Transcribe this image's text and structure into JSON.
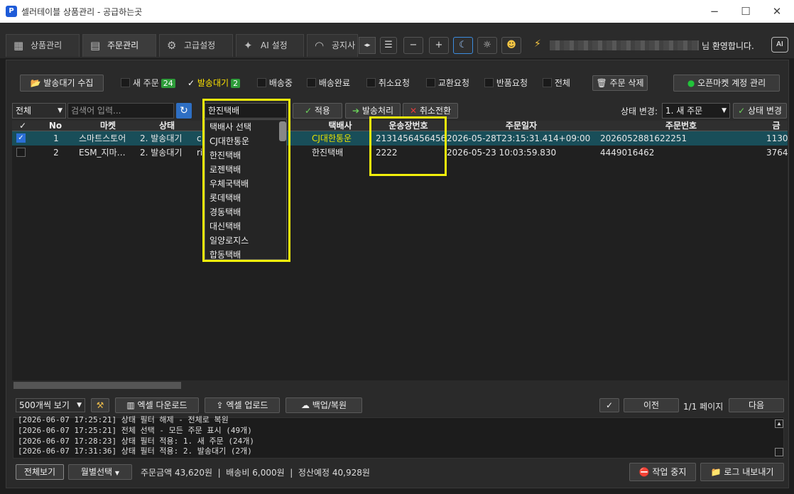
{
  "window": {
    "title": "셀러테이블 상품관리 - 공급하는곳",
    "icon_letter": "P"
  },
  "tabs": [
    {
      "label": "상품관리",
      "icon": "grid-icon"
    },
    {
      "label": "주문관리",
      "icon": "clipboard-icon"
    },
    {
      "label": "고급설정",
      "icon": "gear-icon"
    },
    {
      "label": "AI 설정",
      "icon": "sparkle-icon"
    },
    {
      "label": "공지사",
      "icon": "megaphone-icon"
    }
  ],
  "header": {
    "welcome": "님 환영합니다.",
    "ai_label": "AI",
    "minus": "−",
    "plus": "+"
  },
  "filters": {
    "collect_button": "발송대기 수집",
    "items": [
      {
        "label": "새 주문",
        "badge": "24",
        "checked": false
      },
      {
        "label": "발송대기",
        "badge": "2",
        "checked": true
      },
      {
        "label": "배송중",
        "checked": false
      },
      {
        "label": "배송완료",
        "checked": false
      },
      {
        "label": "취소요청",
        "checked": false
      },
      {
        "label": "교환요청",
        "checked": false
      },
      {
        "label": "반품요청",
        "checked": false
      },
      {
        "label": "전체",
        "checked": false
      }
    ],
    "delete_button": "주문 삭제",
    "openmarket_button": "오픈마켓 계정 관리"
  },
  "toolbar": {
    "scope_select": "전체",
    "search_placeholder": "검색어 입력...",
    "courier_select": "한진택배",
    "apply": "적용",
    "ship": "발송처리",
    "cancel": "취소전환",
    "status_change_label": "상태 변경:",
    "status_select": "1. 새 주문",
    "status_change_button": "상태 변경"
  },
  "dropdown": {
    "items": [
      "택배사 선택",
      "CJ대한통운",
      "한진택배",
      "로젠택배",
      "우체국택배",
      "롯데택배",
      "경동택배",
      "대신택배",
      "일양로지스",
      "합동택배"
    ]
  },
  "table": {
    "headers": {
      "check": "✓",
      "no": "No",
      "market": "마켓",
      "status": "상태",
      "courier": "택배사",
      "tracking": "운송장번호",
      "order_date": "주문일자",
      "order_no": "주문번호",
      "extra": "금"
    },
    "rows": [
      {
        "checked": true,
        "no": "1",
        "market": "스마트스토어",
        "status": "2. 발송대기",
        "col_i": "c",
        "courier": "CJ대한통운",
        "tracking": "2131456456456…",
        "order_date": "2026-05-28T23:15:31.414+09:00",
        "order_no": "2026052881622251",
        "extra": "1130"
      },
      {
        "checked": false,
        "no": "2",
        "market": "ESM_지마…",
        "status": "2. 발송대기",
        "col_i": "ri",
        "courier": "한진택배",
        "tracking": "2222",
        "order_date": "2026-05-23 10:03:59.830",
        "order_no": "4449016462",
        "extra": "3764"
      }
    ]
  },
  "bottom": {
    "page_size": "500개씩 보기",
    "excel_download": "엑셀 다운로드",
    "excel_upload": "엑셀 업로드",
    "backup": "백업/복원",
    "prev": "이전",
    "page_info": "1/1 페이지",
    "next": "다음"
  },
  "log": [
    "[2026-06-07 17:25:21] 상태 필터 해제 - 전체로 복원",
    "[2026-06-07 17:25:21] 전체 선택 - 모든 주문 표시 (49개)",
    "[2026-06-07 17:28:23] 상태 필터 적용: 1. 새 주문 (24개)",
    "[2026-06-07 17:31:36] 상태 필터 적용: 2. 발송대기 (2개)"
  ],
  "status": {
    "view_all": "전체보기",
    "monthly": "월별선택",
    "summary": "주문금액 43,620원  |  배송비 6,000원  |  정산예정 40,928원",
    "stop": "작업 중지",
    "log_export": "로그 내보내기"
  },
  "colors": {
    "accent_green": "#2e9c3a",
    "highlight": "#f2ef0b",
    "selected_row": "#194e59"
  }
}
